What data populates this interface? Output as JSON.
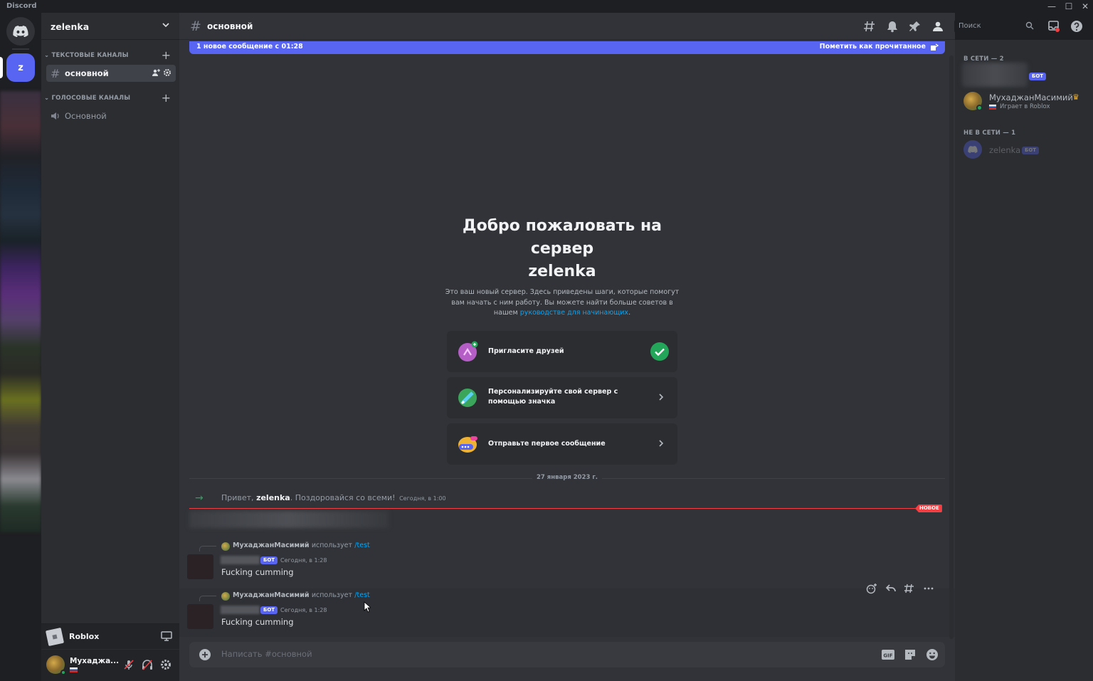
{
  "window": {
    "title": "Discord"
  },
  "server": {
    "name": "zelenka",
    "rail_initial": "z"
  },
  "sidebar": {
    "text_category": "ТЕКСТОВЫЕ КАНАЛЫ",
    "voice_category": "ГОЛОСОВЫЕ КАНАЛЫ",
    "text_channels": [
      {
        "name": "основной"
      }
    ],
    "voice_channels": [
      {
        "name": "Основной"
      }
    ]
  },
  "activity": {
    "name": "Roblox"
  },
  "user": {
    "name": "Мухаджа..."
  },
  "chat": {
    "channel_name": "основной",
    "search_placeholder": "Поиск",
    "new_messages_bar": "1 новое сообщение с 01:28",
    "mark_read": "Пометить как прочитанное",
    "welcome_title_1": "Добро пожаловать на",
    "welcome_title_2": "сервер",
    "welcome_title_3": "zelenka",
    "welcome_desc": "Это ваш новый сервер. Здесь приведены шаги, которые помогут вам начать с ним работу. Вы можете найти больше советов в нашем",
    "welcome_link": "руководстве для начинающих",
    "welcome_period": ".",
    "cards": [
      {
        "label": "Пригласите друзей"
      },
      {
        "label": "Персонализируйте свой сервер с помощью значка"
      },
      {
        "label": "Отправьте первое сообщение"
      }
    ],
    "date_divider": "27 января 2023 г.",
    "join": {
      "prefix": "Привет,",
      "user": "zelenka",
      "suffix": ". Поздоровайся со всеми!",
      "time": "Сегодня, в 1:00"
    },
    "new_badge": "НОВОЕ",
    "messages": [
      {
        "reply_user": "МухаджанМасимий",
        "uses": "использует",
        "command": "/test",
        "bot_tag": "БОТ",
        "time": "Сегодня, в 1:28",
        "text": "Fucking cumming"
      },
      {
        "reply_user": "МухаджанМасимий",
        "uses": "использует",
        "command": "/test",
        "bot_tag": "БОТ",
        "time": "Сегодня, в 1:28",
        "text": "Fucking cumming"
      }
    ],
    "composer_placeholder": "Написать #основной"
  },
  "members": {
    "online_header": "В СЕТИ — 2",
    "offline_header": "НЕ В СЕТИ — 1",
    "online": [
      {
        "bot_tag": "БОТ"
      },
      {
        "name": "МухаджанМасимий",
        "activity": "Играет в Roblox"
      }
    ],
    "offline": [
      {
        "name": "zelenka",
        "bot_tag": "БОТ"
      }
    ]
  },
  "colors": {
    "accent": "#5865f2",
    "online": "#23a55a",
    "danger": "#f23f43",
    "link": "#00a8fc"
  },
  "icons": [
    "discord-logo-icon",
    "hash-icon",
    "bell-icon",
    "pin-icon",
    "members-icon",
    "search-icon",
    "inbox-icon",
    "help-icon",
    "speaker-icon",
    "gear-icon",
    "mic-muted-icon",
    "headphones-muted-icon",
    "screen-share-icon",
    "plus-circle-icon",
    "gif-icon",
    "sticker-icon",
    "emoji-icon",
    "crown-icon"
  ]
}
